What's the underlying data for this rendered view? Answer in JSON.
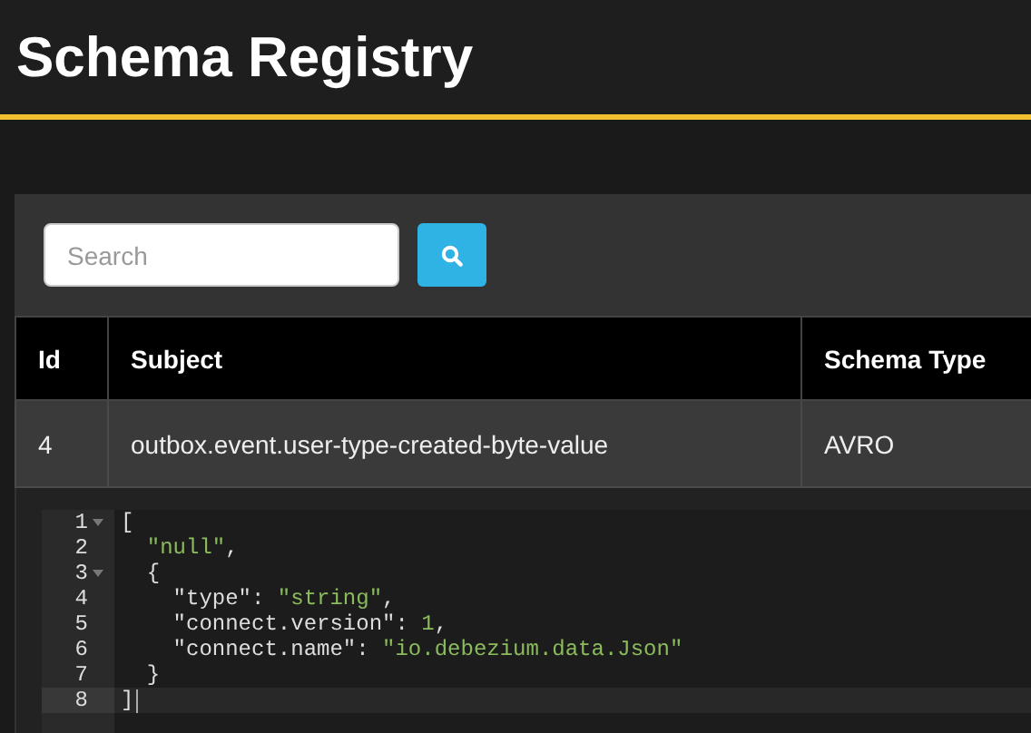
{
  "header": {
    "title": "Schema Registry"
  },
  "search": {
    "placeholder": "Search"
  },
  "table": {
    "columns": [
      "Id",
      "Subject",
      "Schema Type"
    ],
    "rows": [
      {
        "cells": [
          "4",
          "outbox.event.user-type-created-byte-value",
          "AVRO"
        ]
      }
    ]
  },
  "editor": {
    "lines": [
      {
        "number": "1",
        "fold": true,
        "active": false,
        "tokens": [
          {
            "kind": "punct",
            "text": "["
          }
        ]
      },
      {
        "number": "2",
        "fold": false,
        "active": false,
        "tokens": [
          {
            "kind": "string",
            "text": "  \"null\""
          },
          {
            "kind": "punct",
            "text": ","
          }
        ]
      },
      {
        "number": "3",
        "fold": true,
        "active": false,
        "tokens": [
          {
            "kind": "punct",
            "text": "  {"
          }
        ]
      },
      {
        "number": "4",
        "fold": false,
        "active": false,
        "tokens": [
          {
            "kind": "key",
            "text": "    \"type\""
          },
          {
            "kind": "punct",
            "text": ": "
          },
          {
            "kind": "string",
            "text": "\"string\""
          },
          {
            "kind": "punct",
            "text": ","
          }
        ]
      },
      {
        "number": "5",
        "fold": false,
        "active": false,
        "tokens": [
          {
            "kind": "key",
            "text": "    \"connect.version\""
          },
          {
            "kind": "punct",
            "text": ": "
          },
          {
            "kind": "number",
            "text": "1"
          },
          {
            "kind": "punct",
            "text": ","
          }
        ]
      },
      {
        "number": "6",
        "fold": false,
        "active": false,
        "tokens": [
          {
            "kind": "key",
            "text": "    \"connect.name\""
          },
          {
            "kind": "punct",
            "text": ": "
          },
          {
            "kind": "string",
            "text": "\"io.debezium.data.Json\""
          }
        ]
      },
      {
        "number": "7",
        "fold": false,
        "active": false,
        "tokens": [
          {
            "kind": "punct",
            "text": "  }"
          }
        ]
      },
      {
        "number": "8",
        "fold": false,
        "active": true,
        "tokens": [
          {
            "kind": "punct",
            "text": "]"
          }
        ]
      }
    ]
  }
}
